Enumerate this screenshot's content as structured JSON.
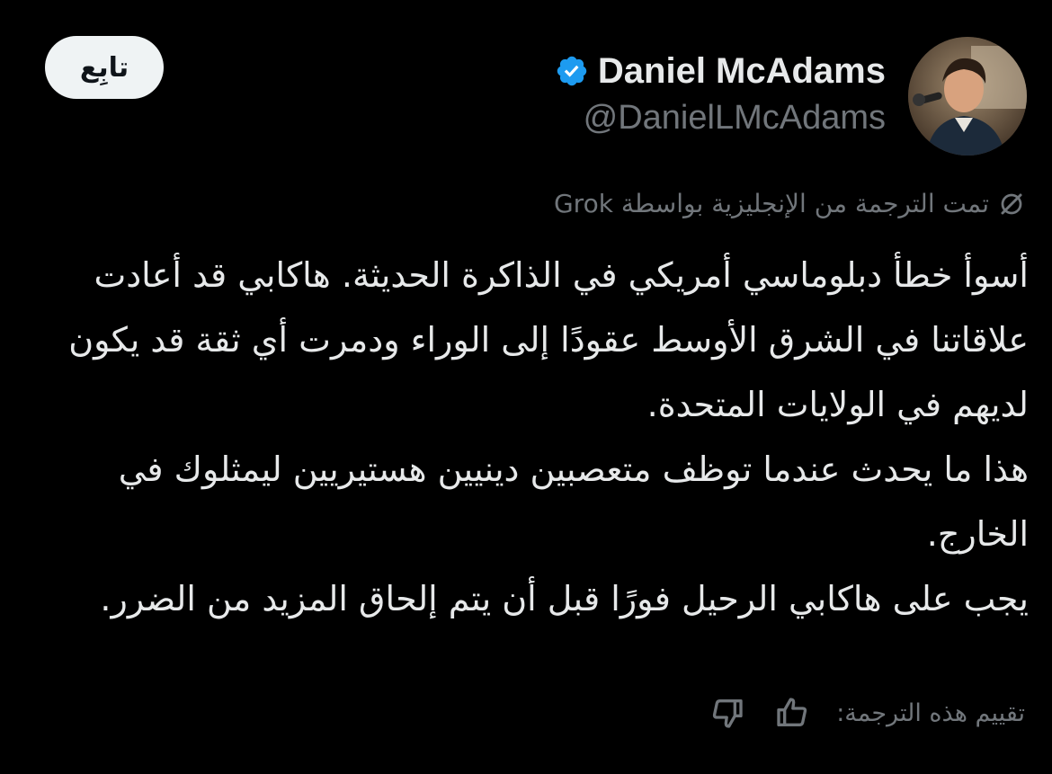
{
  "header": {
    "follow_label": "تابِع",
    "display_name": "Daniel McAdams",
    "handle": "@DanielLMcAdams",
    "verified_icon": "verified-badge-icon",
    "verified_color": "#1d9bf0"
  },
  "translation": {
    "note": "تمت الترجمة من الإنجليزية بواسطة Grok",
    "icon": "grok-icon"
  },
  "tweet": {
    "paragraphs": [
      "أسوأ خطأ دبلوماسي أمريكي في الذاكرة الحديثة. هاكابي قد أعادت علاقاتنا في الشرق الأوسط عقودًا إلى الوراء ودمرت أي ثقة قد يكون لديهم في الولايات المتحدة.",
      "هذا ما يحدث عندما توظف متعصبين دينيين هستيريين ليمثلوك في الخارج.",
      "يجب على هاكابي الرحيل فورًا قبل أن يتم إلحاق المزيد من الضرر."
    ]
  },
  "rating": {
    "label": "تقييم هذه الترجمة:",
    "thumbs_up_icon": "thumbs-up-icon",
    "thumbs_down_icon": "thumbs-down-icon"
  },
  "colors": {
    "background": "#000000",
    "text": "#e7e9ea",
    "secondary": "#71767b",
    "follow_bg": "#eff3f4"
  }
}
